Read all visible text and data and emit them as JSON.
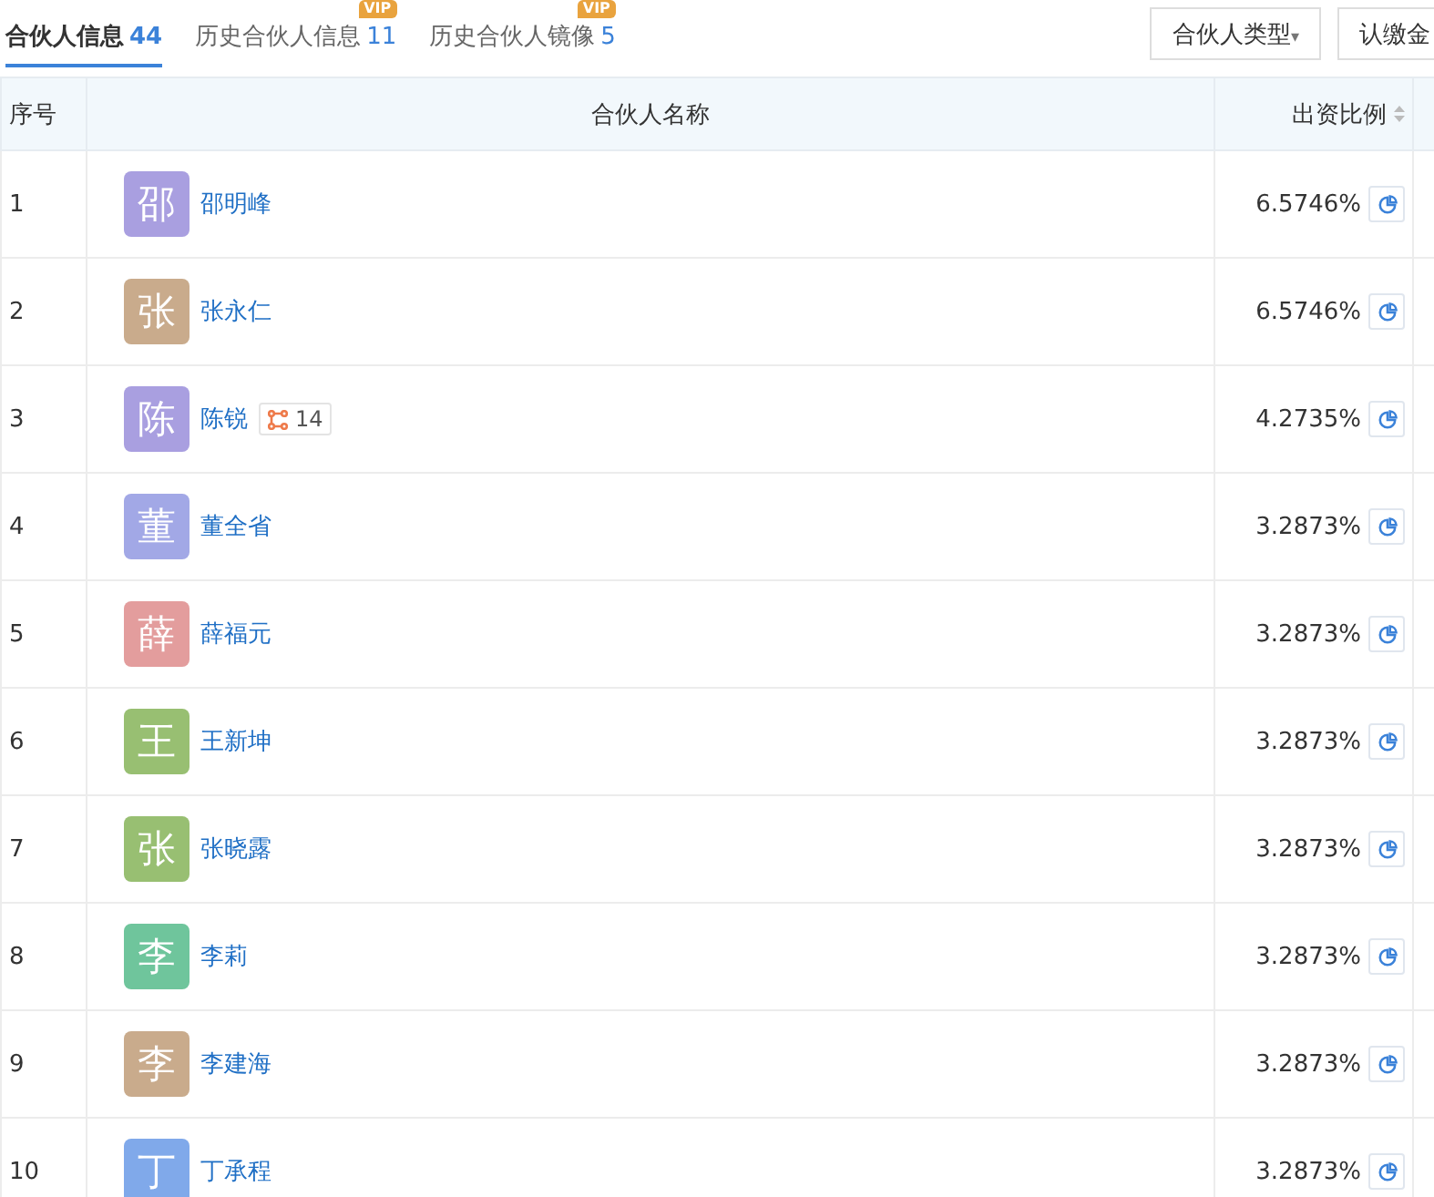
{
  "tabs": [
    {
      "label": "合伙人信息",
      "count": "44",
      "selected": true
    },
    {
      "label": "历史合伙人信息",
      "count": "11",
      "selected": false,
      "badge": "VIP"
    },
    {
      "label": "历史合伙人镜像",
      "count": "5",
      "selected": false,
      "badge": "VIP"
    }
  ],
  "filters": [
    {
      "label": "合伙人类型",
      "caret": "▾"
    },
    {
      "label": "认缴金"
    }
  ],
  "table": {
    "columns": [
      {
        "label": "序号"
      },
      {
        "label": "合伙人名称"
      },
      {
        "label": "出资比例",
        "sortable": true
      }
    ],
    "rows": [
      {
        "index": "1",
        "avatar": "邵",
        "color": "#a99fe0",
        "name": "邵明峰",
        "ratio": "6.5746%"
      },
      {
        "index": "2",
        "avatar": "张",
        "color": "#c9ab8c",
        "name": "张永仁",
        "ratio": "6.5746%"
      },
      {
        "index": "3",
        "avatar": "陈",
        "color": "#a99fe0",
        "name": "陈锐",
        "link_count": "14",
        "ratio": "4.2735%"
      },
      {
        "index": "4",
        "avatar": "董",
        "color": "#a2a8e6",
        "name": "董全省",
        "ratio": "3.2873%"
      },
      {
        "index": "5",
        "avatar": "薛",
        "color": "#e39d9d",
        "name": "薛福元",
        "ratio": "3.2873%"
      },
      {
        "index": "6",
        "avatar": "王",
        "color": "#98bf72",
        "name": "王新坤",
        "ratio": "3.2873%"
      },
      {
        "index": "7",
        "avatar": "张",
        "color": "#98bf72",
        "name": "张晓露",
        "ratio": "3.2873%"
      },
      {
        "index": "8",
        "avatar": "李",
        "color": "#6fc59c",
        "name": "李莉",
        "ratio": "3.2873%"
      },
      {
        "index": "9",
        "avatar": "李",
        "color": "#c9ab8c",
        "name": "李建海",
        "ratio": "3.2873%"
      },
      {
        "index": "10",
        "avatar": "丁",
        "color": "#80a9ea",
        "name": "丁承程",
        "ratio": "3.2873%"
      }
    ]
  }
}
